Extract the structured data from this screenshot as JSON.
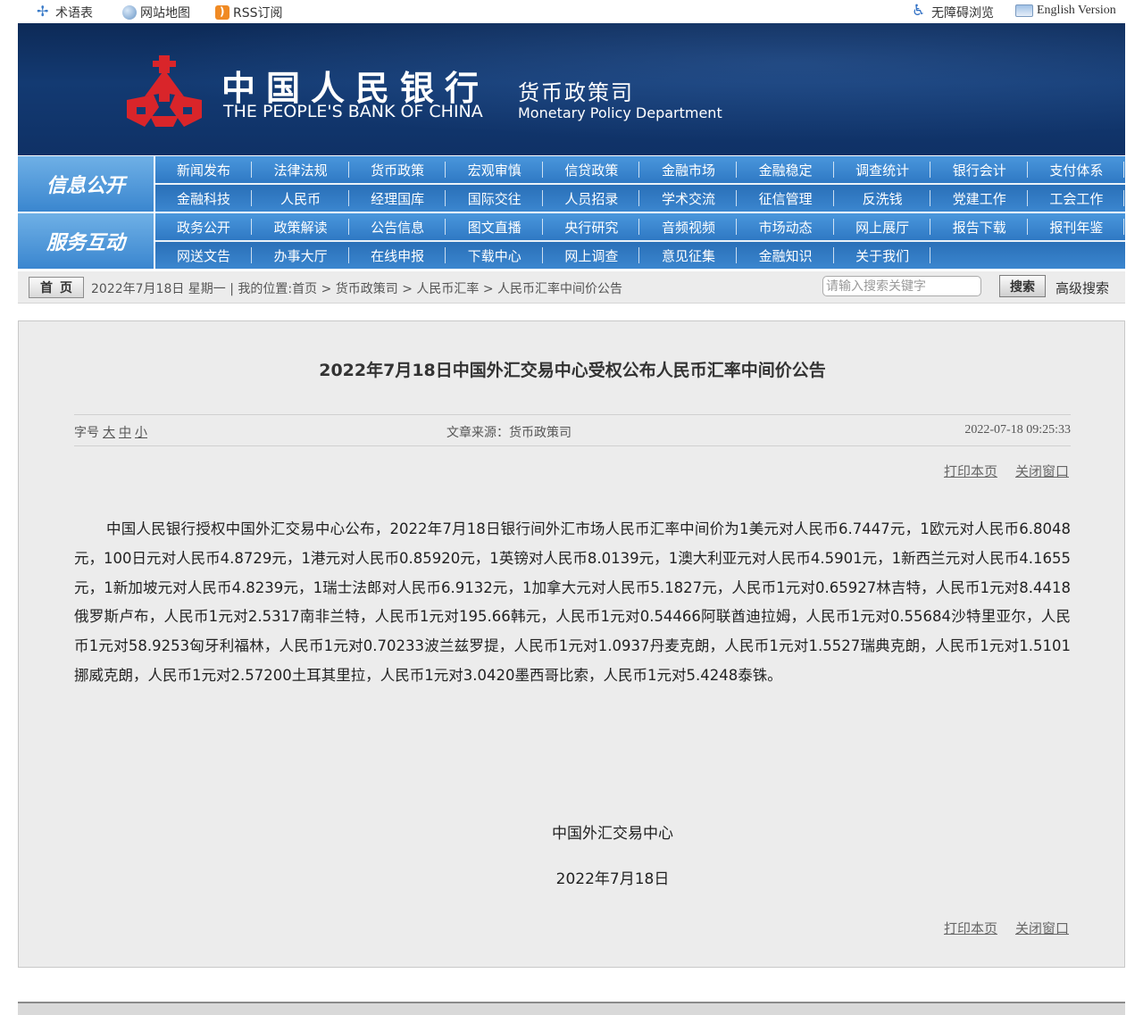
{
  "topbar": {
    "glossary": "术语表",
    "sitemap": "网站地图",
    "rss": "RSS订阅",
    "accessible": "无障碍浏览",
    "english": "English Version"
  },
  "banner": {
    "cn_name": "中国人民银行",
    "en_name": "THE PEOPLE'S BANK OF CHINA",
    "dept_cn": "货币政策司",
    "dept_en": "Monetary Policy Department",
    "colors": {
      "banner": "#133a72",
      "logo": "#d9252a",
      "nav": "#2f79c4"
    }
  },
  "nav": {
    "section1": "信息公开",
    "section2": "服务互动",
    "rows": [
      [
        "新闻发布",
        "法律法规",
        "货币政策",
        "宏观审慎",
        "信贷政策",
        "金融市场",
        "金融稳定",
        "调查统计",
        "银行会计",
        "支付体系"
      ],
      [
        "金融科技",
        "人民币",
        "经理国库",
        "国际交往",
        "人员招录",
        "学术交流",
        "征信管理",
        "反洗钱",
        "党建工作",
        "工会工作"
      ],
      [
        "政务公开",
        "政策解读",
        "公告信息",
        "图文直播",
        "央行研究",
        "音频视频",
        "市场动态",
        "网上展厅",
        "报告下载",
        "报刊年鉴"
      ],
      [
        "网送文告",
        "办事大厅",
        "在线申报",
        "下载中心",
        "网上调查",
        "意见征集",
        "金融知识",
        "关于我们"
      ]
    ]
  },
  "crumb": {
    "home": "首页",
    "text": "2022年7月18日 星期一 | 我的位置:首页 > 货币政策司 > 人民币汇率 > 人民币汇率中间价公告",
    "search_placeholder": "请输入搜索关键字",
    "search_button": "搜索",
    "advanced": "高级搜索"
  },
  "article": {
    "title": "2022年7月18日中国外汇交易中心受权公布人民币汇率中间价公告",
    "font_label": "字号",
    "font_large": "大",
    "font_medium": "中",
    "font_small": "小",
    "source": "文章来源：货币政策司",
    "date": "2022-07-18 09:25:33",
    "print": "打印本页",
    "close": "关闭窗口",
    "body": "中国人民银行授权中国外汇交易中心公布，2022年7月18日银行间外汇市场人民币汇率中间价为1美元对人民币6.7447元，1欧元对人民币6.8048元，100日元对人民币4.8729元，1港元对人民币0.85920元，1英镑对人民币8.0139元，1澳大利亚元对人民币4.5901元，1新西兰元对人民币4.1655元，1新加坡元对人民币4.8239元，1瑞士法郎对人民币6.9132元，1加拿大元对人民币5.1827元，人民币1元对0.65927林吉特，人民币1元对8.4418俄罗斯卢布，人民币1元对2.5317南非兰特，人民币1元对195.66韩元，人民币1元对0.54466阿联酋迪拉姆，人民币1元对0.55684沙特里亚尔，人民币1元对58.9253匈牙利福林，人民币1元对0.70233波兰兹罗提，人民币1元对1.0937丹麦克朗，人民币1元对1.5527瑞典克朗，人民币1元对1.5101挪威克朗，人民币1元对2.57200土耳其里拉，人民币1元对3.0420墨西哥比索，人民币1元对5.4248泰铢。",
    "sign_org": "中国外汇交易中心",
    "sign_date": "2022年7月18日"
  }
}
